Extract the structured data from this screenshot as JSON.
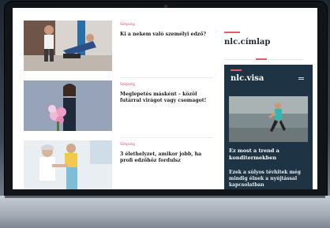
{
  "articles": [
    {
      "category": "Szépség",
      "title": "Ki a nekem való személyi edző?"
    },
    {
      "category": "Szépség",
      "title": "Meglepetés másként – közöl futárral virágot vagy csomagot!"
    },
    {
      "category": "Szépség",
      "title": "3 élethelyzet, amikor jobb, ha profi edzőhöz fordulsz"
    }
  ],
  "sidebar": {
    "title": "nlc.címlap"
  },
  "promo": {
    "title": "nlc.visa",
    "headline": "Ez most a trend a konditermekben",
    "subheadline": "Ezek a súlyos tévhitek még mindig élnek a nyújtással kapcsolatban"
  },
  "colors": {
    "accent": "#e85a6d",
    "promo_bg": "#1e3445"
  }
}
